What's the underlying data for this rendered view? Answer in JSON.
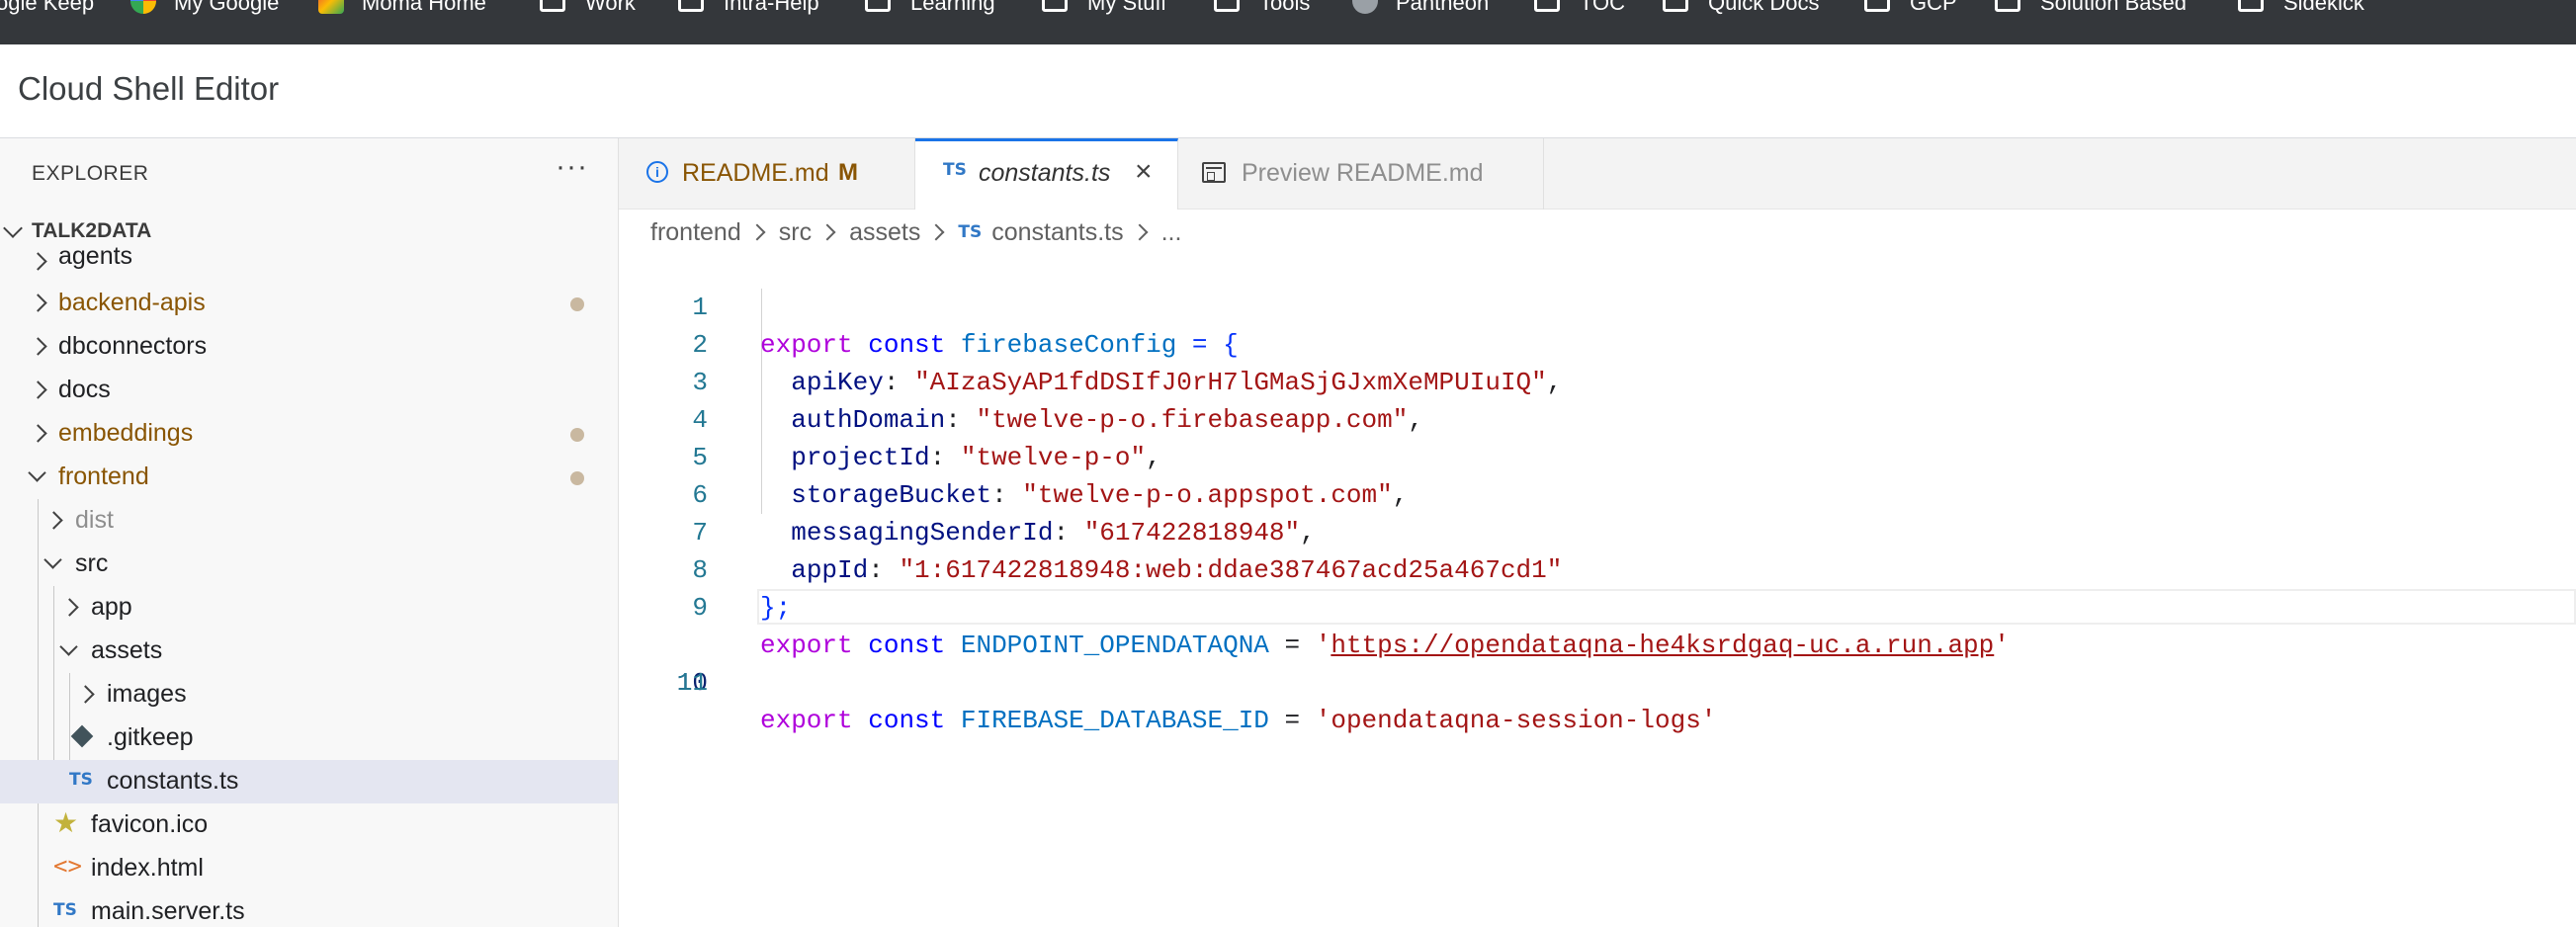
{
  "bookmarks": [
    {
      "label": "ogle Keep",
      "icon": "none"
    },
    {
      "label": "My Google",
      "icon": "google-icon"
    },
    {
      "label": "Moma Home",
      "icon": "moma-icon"
    },
    {
      "label": "Work",
      "icon": "folder-icon"
    },
    {
      "label": "Intra-Help",
      "icon": "folder-icon"
    },
    {
      "label": "Learning",
      "icon": "folder-icon"
    },
    {
      "label": "My Stuff",
      "icon": "folder-icon"
    },
    {
      "label": "Tools",
      "icon": "folder-icon"
    },
    {
      "label": "Pantheon",
      "icon": "pantheon-icon"
    },
    {
      "label": "TOC",
      "icon": "folder-icon"
    },
    {
      "label": "Quick Docs",
      "icon": "folder-icon"
    },
    {
      "label": "GCP",
      "icon": "folder-icon"
    },
    {
      "label": "Solution Based",
      "icon": "folder-icon"
    },
    {
      "label": "Sidekick",
      "icon": "folder-icon"
    }
  ],
  "app": {
    "title": "Cloud Shell Editor"
  },
  "explorer": {
    "header": "EXPLORER",
    "more": "···",
    "root": "TALK2DATA",
    "items": [
      {
        "label": "agents"
      },
      {
        "label": "backend-apis"
      },
      {
        "label": "dbconnectors"
      },
      {
        "label": "docs"
      },
      {
        "label": "embeddings"
      },
      {
        "label": "frontend"
      },
      {
        "label": "dist"
      },
      {
        "label": "src"
      },
      {
        "label": "app"
      },
      {
        "label": "assets"
      },
      {
        "label": "images"
      },
      {
        "label": ".gitkeep"
      },
      {
        "label": "constants.ts"
      },
      {
        "label": "favicon.ico"
      },
      {
        "label": "index.html"
      },
      {
        "label": "main.server.ts"
      }
    ],
    "ts_badge": "TS"
  },
  "tabs": [
    {
      "label": "README.md",
      "badge": "M",
      "icon": "info-icon"
    },
    {
      "label": "constants.ts",
      "icon": "typescript-icon",
      "close": "×"
    },
    {
      "label": "Preview README.md",
      "icon": "preview-icon"
    }
  ],
  "breadcrumb": [
    "frontend",
    "src",
    "assets",
    "constants.ts",
    "..."
  ],
  "editor": {
    "current_line": 10,
    "lines": [
      {
        "n": "1"
      },
      {
        "n": "2"
      },
      {
        "n": "3"
      },
      {
        "n": "4"
      },
      {
        "n": "5"
      },
      {
        "n": "6"
      },
      {
        "n": "7"
      },
      {
        "n": "8"
      },
      {
        "n": "9"
      },
      {
        "n": "10"
      },
      {
        "n": "11"
      }
    ],
    "tokens": {
      "export": "export",
      "const": "const",
      "firebaseConfig": "firebaseConfig",
      "eq_open": " = {",
      "apiKey": "apiKey",
      "apiKey_val": "\"AIzaSyAP1fdDSIfJ0rH7lGMaSjGJxmXeMPUIuIQ\"",
      "authDomain": "authDomain",
      "authDomain_val": "\"twelve-p-o.firebaseapp.com\"",
      "projectId": "projectId",
      "projectId_val": "\"twelve-p-o\"",
      "storageBucket": "storageBucket",
      "storageBucket_val": "\"twelve-p-o.appspot.com\"",
      "messagingSenderId": "messagingSenderId",
      "messagingSenderId_val": "\"617422818948\"",
      "appId": "appId",
      "appId_val": "\"1:617422818948:web:ddae387467acd25a467cd1\"",
      "close": "};",
      "endpoint_name": "ENDPOINT_OPENDATAQNA",
      "endpoint_url": "https://opendataqna-he4ksrdgaq-uc.a.run.app",
      "db_name": "FIREBASE_DATABASE_ID",
      "db_val": "'opendataqna-session-logs'"
    }
  }
}
